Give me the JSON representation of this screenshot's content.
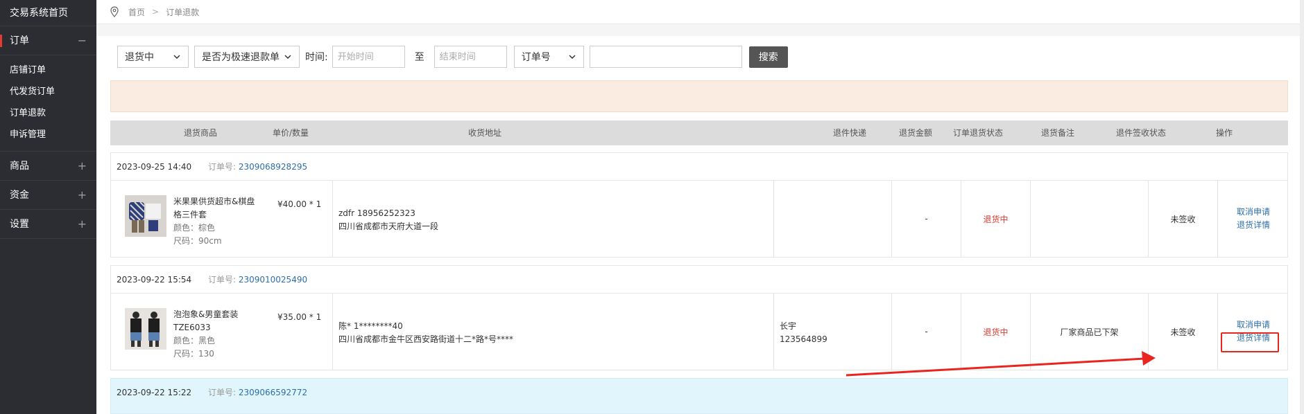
{
  "sidebar": {
    "home": "交易系统首页",
    "groups": [
      {
        "label": "订单",
        "toggle": "−"
      },
      {
        "label": "商品",
        "toggle": "+"
      },
      {
        "label": "资金",
        "toggle": "+"
      },
      {
        "label": "设置",
        "toggle": "+"
      }
    ],
    "sub_items": [
      "店铺订单",
      "代发货订单",
      "订单退款",
      "申诉管理"
    ]
  },
  "breadcrumb": {
    "home": "首页",
    "separator": ">",
    "current": "订单退款"
  },
  "filter": {
    "status_select": "退货中",
    "fast_refund_select": "是否为极速退款单",
    "time_label": "时间:",
    "start_placeholder": "开始时间",
    "to_label": "至",
    "end_placeholder": "结束时间",
    "order_select": "订单号",
    "search_value": "",
    "search_button": "搜索"
  },
  "table": {
    "headers": [
      "退货商品",
      "单价/数量",
      "收货地址",
      "退件快递",
      "退货金额",
      "订单退货状态",
      "退货备注",
      "退件签收状态",
      "操作"
    ]
  },
  "orders": [
    {
      "date": "2023-09-25 14:40",
      "order_no_label": "订单号:",
      "order_no": "2309068928295",
      "product_name": "米果果供货超市&棋盘格三件套",
      "color": "颜色：棕色",
      "size": "尺码：90cm",
      "price": "¥40.00 * 1",
      "receiver": "zdfr 18956252323",
      "address": "四川省成都市天府大道一段",
      "express_name": "",
      "express_no": "",
      "amount": "-",
      "status": "退货中",
      "remark": "",
      "sign_status": "未签收",
      "op_cancel": "取消申请",
      "op_detail": "退货详情"
    },
    {
      "date": "2023-09-22 15:54",
      "order_no_label": "订单号:",
      "order_no": "2309010025490",
      "product_name": "泡泡象&男童套装TZE6033",
      "color": "颜色：黑色",
      "size": "尺码：130",
      "price": "¥35.00 * 1",
      "receiver": "陈* 1********40",
      "address": "四川省成都市金牛区西安路街道十二*路*号****",
      "express_name": "长宇",
      "express_no": "123564899",
      "amount": "-",
      "status": "退货中",
      "remark": "厂家商品已下架",
      "sign_status": "未签收",
      "op_cancel": "取消申请",
      "op_detail": "退货详情"
    },
    {
      "date": "2023-09-22 15:22",
      "order_no_label": "订单号:",
      "order_no": "2309066592772"
    }
  ],
  "colors": {
    "accent_red": "#e23b30",
    "link_blue": "#2d6ea8",
    "sidebar_bg": "#2b2d33"
  }
}
